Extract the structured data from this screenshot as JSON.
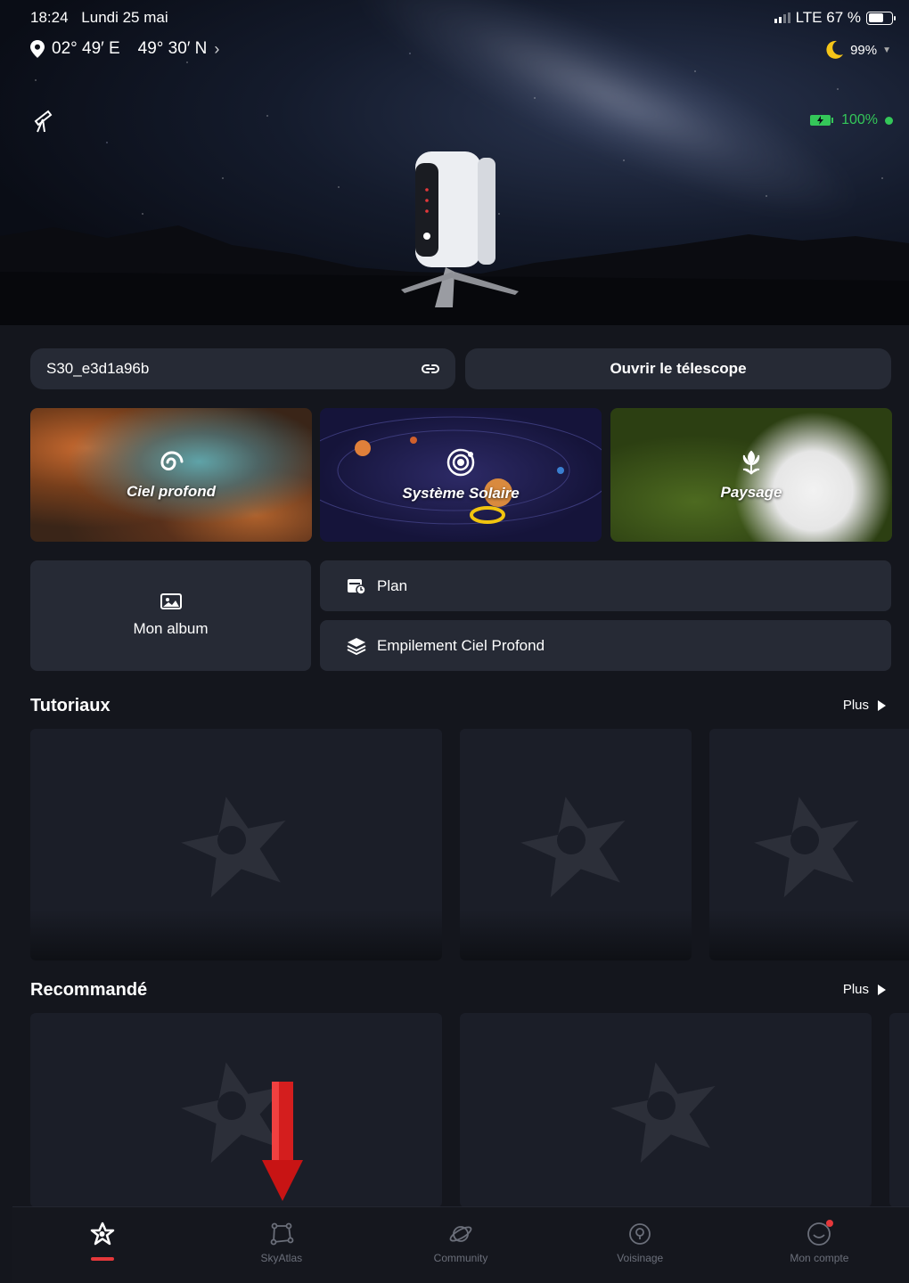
{
  "status_bar": {
    "time": "18:24",
    "date": "Lundi 25 mai",
    "network": "LTE 67 %"
  },
  "location": {
    "longitude": "02° 49′ E",
    "latitude": "49° 30′ N"
  },
  "moon": {
    "illumination": "99%"
  },
  "device": {
    "battery": "100%",
    "name": "S30_e3d1a96b",
    "open_label": "Ouvrir le télescope"
  },
  "modes": [
    {
      "label": "Ciel profond"
    },
    {
      "label": "Système Solaire"
    },
    {
      "label": "Paysage"
    }
  ],
  "tools": {
    "album": "Mon album",
    "plan": "Plan",
    "stacking": "Empilement Ciel Profond"
  },
  "tutorials": {
    "title": "Tutoriaux",
    "more": "Plus"
  },
  "recommended": {
    "title": "Recommandé",
    "more": "Plus"
  },
  "nav": [
    {
      "label": ""
    },
    {
      "label": "SkyAtlas"
    },
    {
      "label": "Community"
    },
    {
      "label": "Voisinage"
    },
    {
      "label": "Mon compte"
    }
  ],
  "colors": {
    "accent": "#e5383b",
    "battery_green": "#34c759",
    "card_bg": "#262a35",
    "page_bg": "#14161d"
  }
}
